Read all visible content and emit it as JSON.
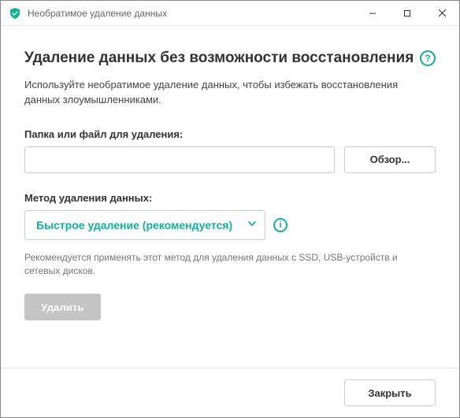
{
  "window": {
    "title": "Необратимое удаление данных"
  },
  "page": {
    "heading": "Удаление данных без возможности восстановления",
    "description": "Используйте необратимое удаление данных, чтобы избежать восстановления данных злоумышленниками."
  },
  "path": {
    "label": "Папка или файл для удаления:",
    "value": "",
    "browse_label": "Обзор..."
  },
  "method": {
    "label": "Метод удаления данных:",
    "selected": "Быстрое удаление (рекомендуется)",
    "hint": "Рекомендуется применять этот метод для удаления данных с SSD, USB-устройств и сетевых дисков."
  },
  "actions": {
    "delete_label": "Удалить",
    "close_label": "Закрыть"
  },
  "icons": {
    "help": "?",
    "info": "i"
  }
}
